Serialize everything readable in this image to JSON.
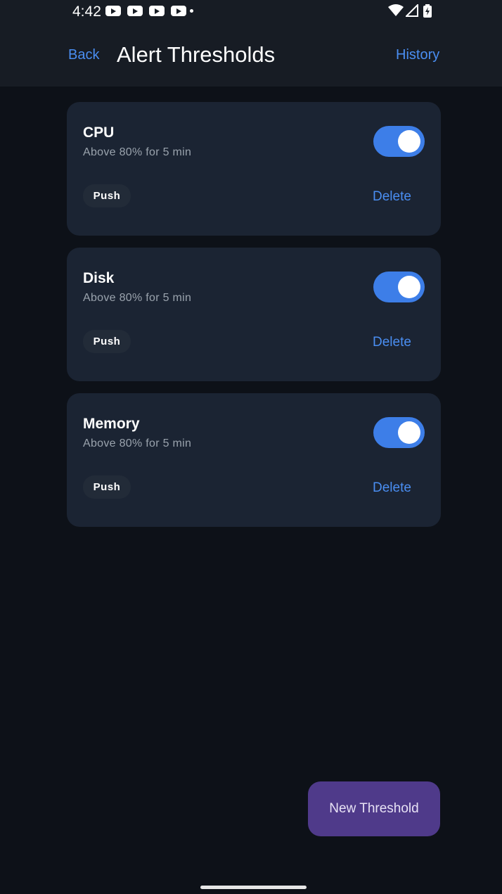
{
  "status_bar": {
    "time": "4:42"
  },
  "nav": {
    "back_label": "Back",
    "title": "Alert Thresholds",
    "history_label": "History"
  },
  "thresholds": [
    {
      "name": "CPU",
      "condition": "Above 80% for 5 min",
      "enabled": true,
      "channel": "Push",
      "delete_label": "Delete"
    },
    {
      "name": "Disk",
      "condition": "Above 80% for 5 min",
      "enabled": true,
      "channel": "Push",
      "delete_label": "Delete"
    },
    {
      "name": "Memory",
      "condition": "Above 80% for 5 min",
      "enabled": true,
      "channel": "Push",
      "delete_label": "Delete"
    }
  ],
  "fab": {
    "label": "New Threshold"
  },
  "colors": {
    "accent": "#4a8ef2",
    "toggle_on": "#3d7ee8",
    "fab": "#4f3a8a",
    "card": "#1b2433",
    "background": "#0d1118"
  }
}
